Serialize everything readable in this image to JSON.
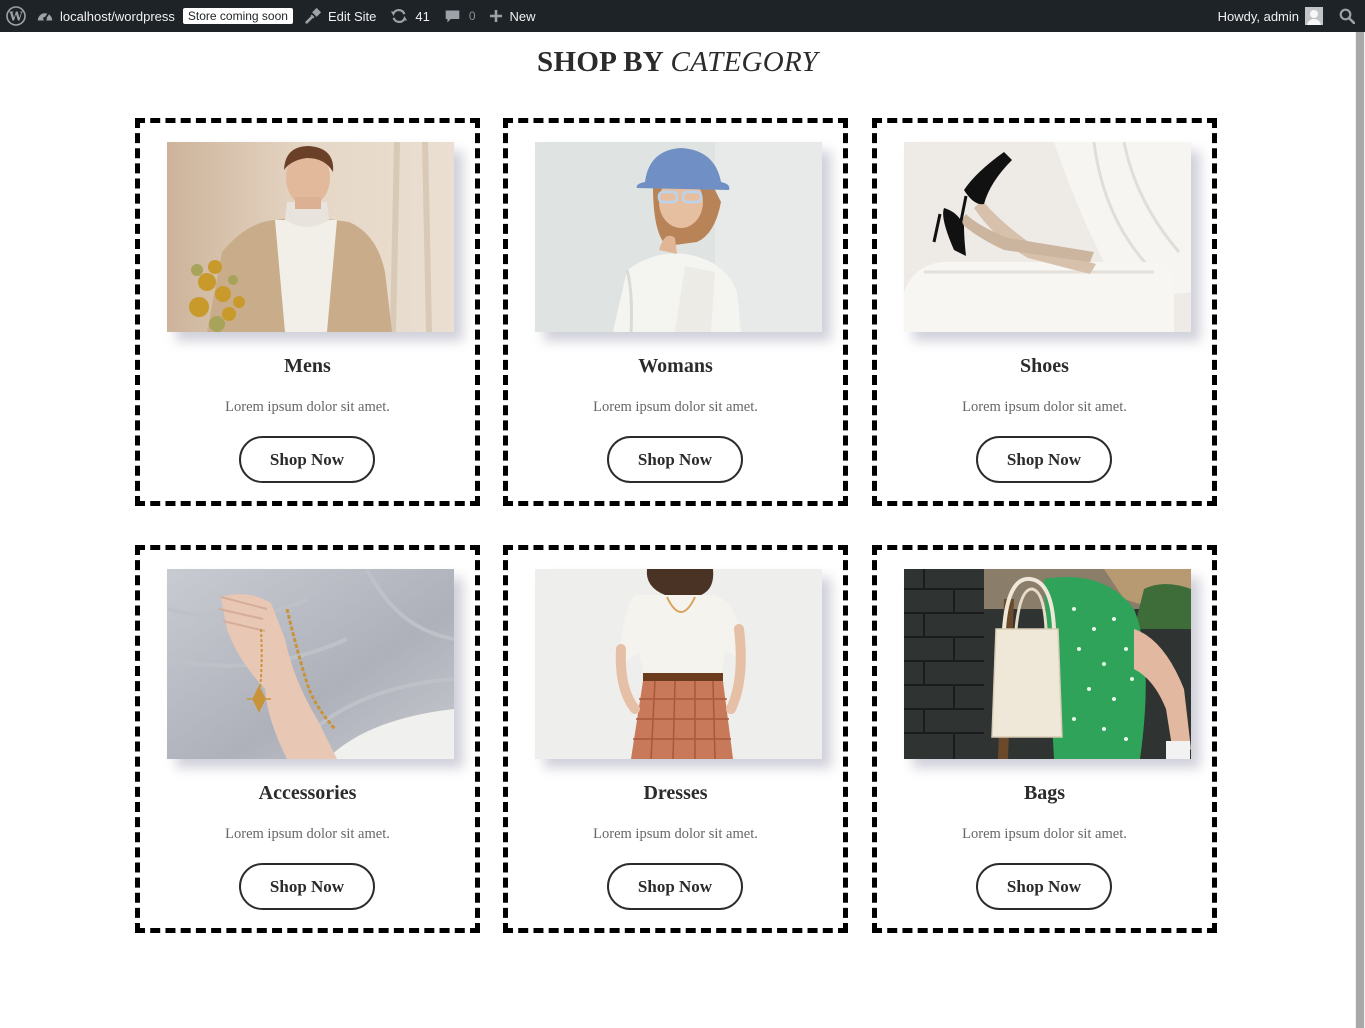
{
  "adminbar": {
    "site_name": "localhost/wordpress",
    "store_badge": "Store coming soon",
    "edit_site": "Edit Site",
    "updates_count": "41",
    "comments_count": "0",
    "new_label": "New",
    "howdy": "Howdy, admin",
    "icons": {
      "wp": "wordpress-logo-icon",
      "site": "dashboard-gauge-icon",
      "edit": "brush-icon",
      "updates": "refresh-icon",
      "comments": "comment-bubble-icon",
      "new": "plus-icon",
      "search": "search-icon"
    },
    "colors": {
      "background": "#1d2327",
      "text": "#f0f0f1"
    }
  },
  "section": {
    "title_main": "SHOP BY",
    "title_emphasis": "CATEGORY"
  },
  "categories": [
    {
      "title": "Mens",
      "description": "Lorem ipsum dolor sit amet.",
      "button": "Shop Now",
      "image": "man in beige trench coat holding dried flowers"
    },
    {
      "title": "Womans",
      "description": "Lorem ipsum dolor sit amet.",
      "button": "Shop Now",
      "image": "woman in blue bucket hat and sunglasses"
    },
    {
      "title": "Shoes",
      "description": "Lorem ipsum dolor sit amet.",
      "button": "Shop Now",
      "image": "legs in black high heels over white bathtub"
    },
    {
      "title": "Accessories",
      "description": "Lorem ipsum dolor sit amet.",
      "button": "Shop Now",
      "image": "hand with gold chain bracelet on grey fabric"
    },
    {
      "title": "Dresses",
      "description": "Lorem ipsum dolor sit amet.",
      "button": "Shop Now",
      "image": "woman in white top and checkered skirt"
    },
    {
      "title": "Bags",
      "description": "Lorem ipsum dolor sit amet.",
      "button": "Shop Now",
      "image": "canvas tote bag with green polka dot dress"
    }
  ],
  "colors": {
    "card_border": "#000000",
    "text": "#2b2b2b",
    "muted": "#666666"
  }
}
